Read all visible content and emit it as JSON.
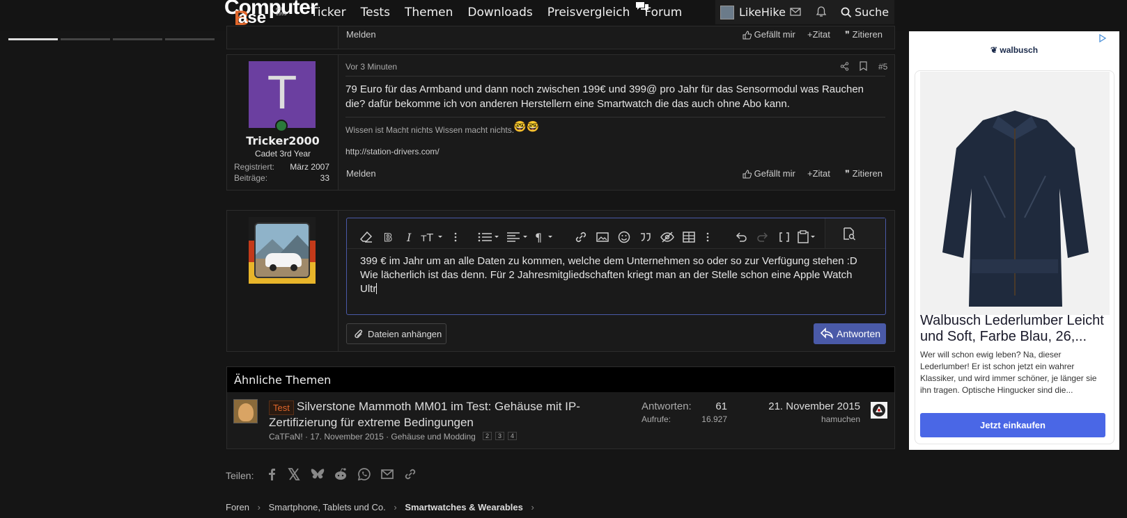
{
  "site": {
    "logo_line1": "Computer",
    "logo_line2": "ase",
    "logo_b": "B",
    "logo_est": "est. 1999"
  },
  "nav": [
    "Ticker",
    "Tests",
    "Themen",
    "Downloads",
    "Preisvergleich",
    "Forum"
  ],
  "user": {
    "name": "LikeHike",
    "search_label": "Suche"
  },
  "prev_post": {
    "report": "Melden",
    "like": "Gefällt mir",
    "zitat": "Zitat",
    "zitieren": "Zitieren"
  },
  "post": {
    "time": "Vor 3 Minuten",
    "number": "#5",
    "author": "Tricker2000",
    "avatar_letter": "T",
    "rank": "Cadet 3rd Year",
    "registered_label": "Registriert:",
    "registered_value": "März 2007",
    "posts_label": "Beiträge:",
    "posts_value": "33",
    "body_line1": "79 Euro für das Armband und dann noch zwischen 199€ und 399@ pro Jahr für das Sensormodul was Rauchen",
    "body_line2": "die? dafür bekomme ich von anderen Herstellern eine Smartwatch die das auch ohne Abo kann.",
    "signature": "Wissen ist Macht nichts Wissen macht nichts.",
    "signature_link": "http://station-drivers.com/",
    "report": "Melden",
    "like": "Gefällt mir",
    "zitat": "Zitat",
    "zitieren": "Zitieren"
  },
  "editor": {
    "line1": "399 € im Jahr um an alle Daten zu kommen, welche dem Unternehmen so oder so zur Verfügung stehen :D",
    "line2": "Wie lächerlich ist das denn. Für 2 Jahresmitgliedschaften kriegt man an der Stelle schon eine Apple Watch",
    "line3": "Ultr",
    "attach_label": "Dateien anhängen",
    "reply_label": "Antworten"
  },
  "similar": {
    "header": "Ähnliche Themen",
    "tag": "Test",
    "title_line1": "Silverstone Mammoth MM01 im Test: Gehäuse mit IP-",
    "title_line2": "Zertifizierung für extreme Bedingungen",
    "meta": "CaTFaN! · 17. November 2015 · Gehäuse und Modding",
    "pages": [
      "2",
      "3",
      "4"
    ],
    "replies_label": "Antworten:",
    "replies_value": "61",
    "views_label": "Aufrufe:",
    "views_value": "16.927",
    "last_date": "21. November 2015",
    "last_user": "hamuchen"
  },
  "share": {
    "label": "Teilen:",
    "items": [
      "facebook-icon",
      "x-icon",
      "bluesky-icon",
      "reddit-icon",
      "whatsapp-icon",
      "email-icon",
      "link-icon"
    ]
  },
  "breadcrumb": [
    "Foren",
    "Smartphone, Tablets und Co.",
    "Smartwatches & Wearables"
  ],
  "ad": {
    "brand": "walbusch",
    "title_line1": "Walbusch Lederlumber Leicht",
    "title_line2": "und Soft, Farbe Blau, 26,...",
    "desc_line1": "Wer will schon ewig leben? Na, dieser",
    "desc_line2": "Lederlumber! Er ist schon jetzt ein wahrer",
    "desc_line3": "Klassiker, und wird immer schöner, je länger sie",
    "desc_line4": "ihn tragen. Optische Hingucker sind die...",
    "cta": "Jetzt einkaufen",
    "accent": "#4a67e6"
  },
  "colors": {
    "accent": "#4a5aa8",
    "avatar_bg": "#6b3fa0",
    "tag": "#e0662b"
  }
}
